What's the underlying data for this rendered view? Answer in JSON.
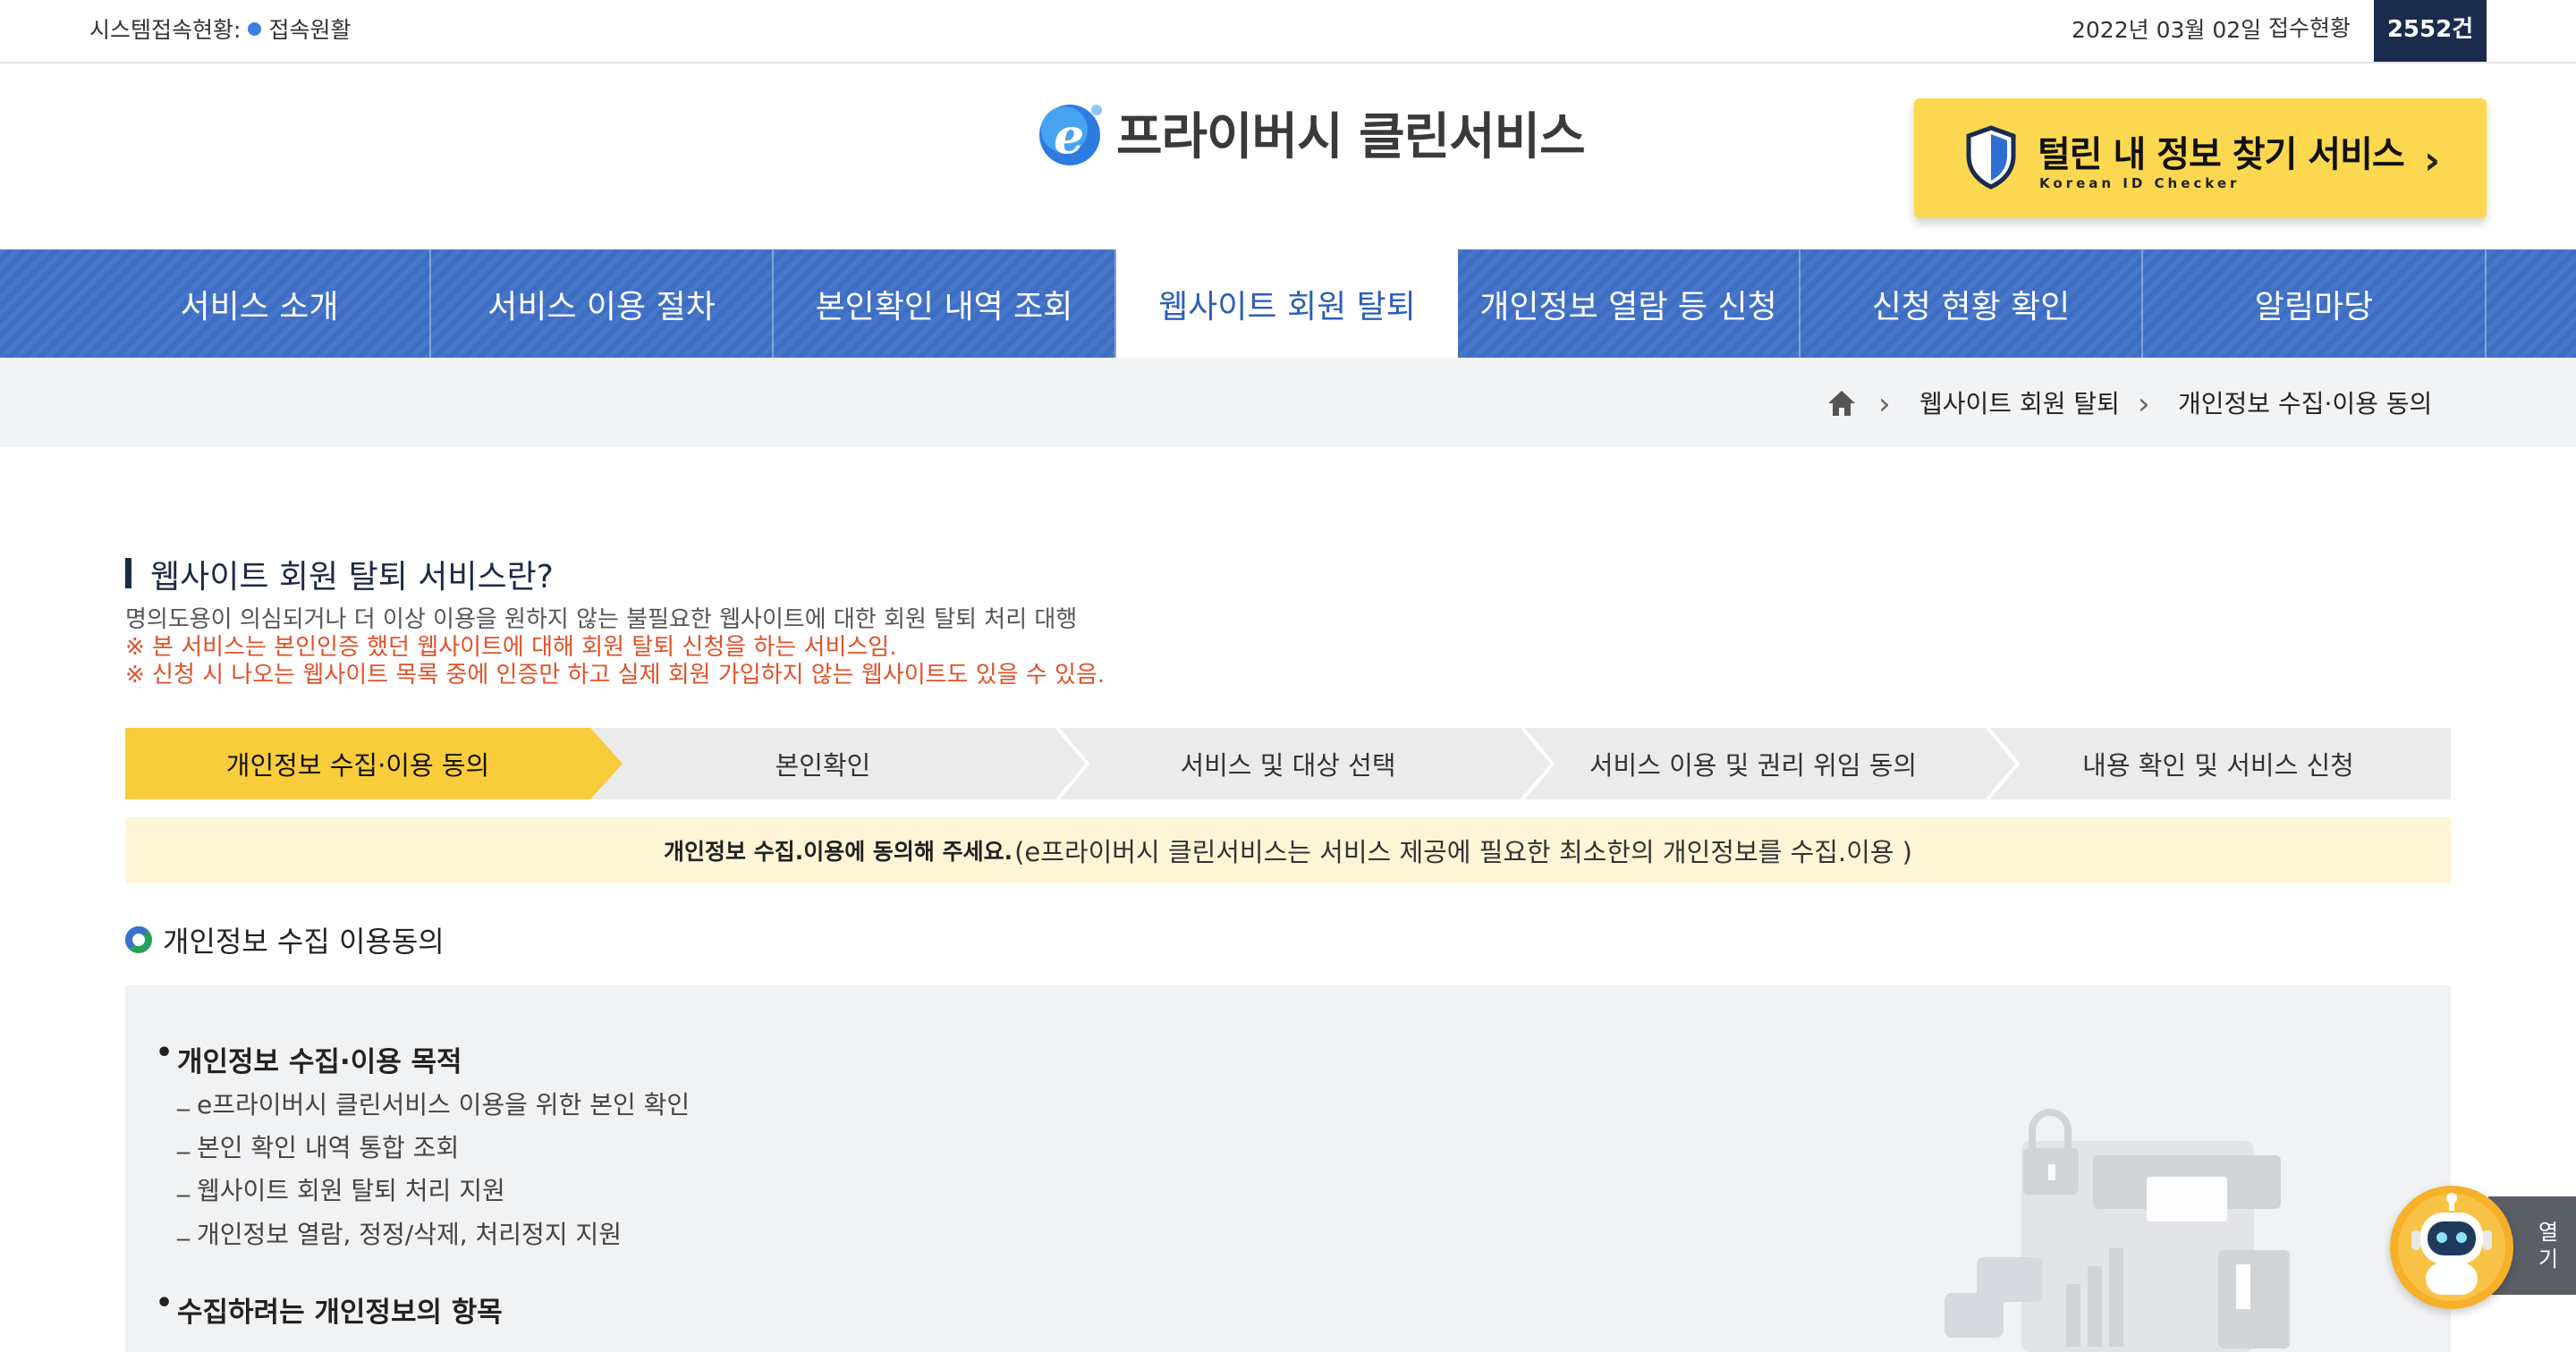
{
  "topbar": {
    "status_label": "시스템접속현황:",
    "status_value": "접속원활",
    "date": "2022년 03월 02일",
    "receipt_label": "접수현황",
    "receipt_count": "2552건"
  },
  "header": {
    "logo_text": "프라이버시 클린서비스",
    "promo_title": "털린 내 정보 찾기 서비스",
    "promo_subtitle": "Korean ID Checker"
  },
  "nav": {
    "items": [
      {
        "label": "서비스 소개"
      },
      {
        "label": "서비스 이용 절차"
      },
      {
        "label": "본인확인 내역 조회"
      },
      {
        "label": "웹사이트 회원 탈퇴"
      },
      {
        "label": "개인정보 열람 등 신청"
      },
      {
        "label": "신청 현황 확인"
      },
      {
        "label": "알림마당"
      }
    ],
    "active_index": 3
  },
  "breadcrumb": {
    "items": [
      "웹사이트 회원 탈퇴",
      "개인정보 수집·이용 동의"
    ]
  },
  "section": {
    "title": "웹사이트 회원 탈퇴 서비스란?",
    "desc1": "명의도용이 의심되거나 더 이상 이용을 원하지 않는 불필요한 웹사이트에 대한 회원 탈퇴 처리 대행",
    "desc2": "※ 본 서비스는 본인인증 했던 웹사이트에 대해 회원 탈퇴 신청을 하는 서비스임.",
    "desc3": "※ 신청 시 나오는 웹사이트 목록 중에 인증만 하고 실제 회원 가입하지 않는 웹사이트도 있을 수 있음."
  },
  "steps": {
    "items": [
      {
        "label": "개인정보 수집·이용 동의"
      },
      {
        "label": "본인확인"
      },
      {
        "label": "서비스 및 대상 선택"
      },
      {
        "label": "서비스 이용 및 권리 위임 동의"
      },
      {
        "label": "내용 확인 및 서비스 신청"
      }
    ],
    "active_index": 0
  },
  "notice": {
    "bold": "개인정보 수집.이용에 동의해 주세요.",
    "text": "(e프라이버시 클린서비스는 서비스 제공에 필요한 최소한의 개인정보를 수집.이용 )"
  },
  "consent": {
    "title": "개인정보 수집 이용동의",
    "purpose_heading": "개인정보 수집·이용 목적",
    "purpose_items": [
      "e프라이버시 클린서비스 이용을 위한 본인 확인",
      "본인 확인 내역 통합 조회",
      "웹사이트 회원 탈퇴 처리 지원",
      "개인정보 열람, 정정/삭제, 처리정지 지원"
    ],
    "items_heading": "수집하려는 개인정보의 항목"
  },
  "chatbot": {
    "open_label_1": "열",
    "open_label_2": "기"
  },
  "colors": {
    "nav_blue": "#3d6ec4",
    "step_active": "#f9cc3b",
    "warning_red": "#e0522a",
    "promo_yellow": "#fbd84f",
    "count_bg": "#1a2c4e"
  }
}
